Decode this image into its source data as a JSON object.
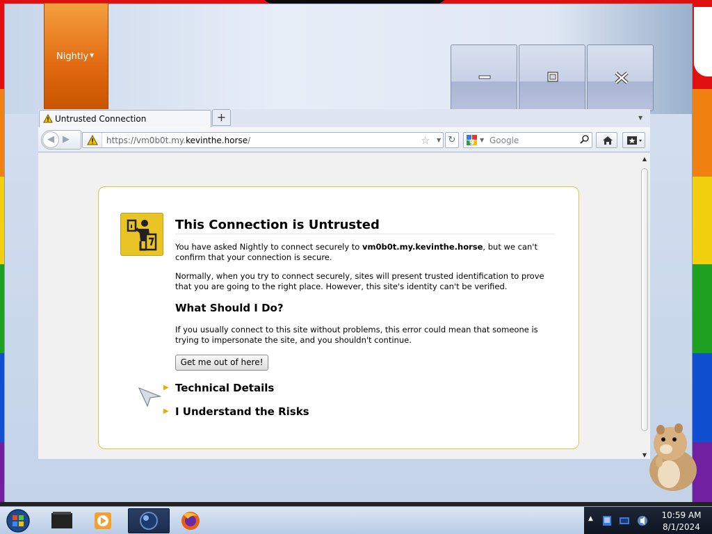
{
  "app": {
    "menu_button_label": "Nightly",
    "caption_buttons": [
      "minimize",
      "maximize",
      "close"
    ]
  },
  "tabs": [
    {
      "title": "Untrusted Connection",
      "icon": "warning-icon",
      "active": true
    }
  ],
  "toolbar": {
    "url_prefix": "https://vm0b0t.my.",
    "url_domain": "kevinthe.horse",
    "url_suffix": "/",
    "search_placeholder": "Google"
  },
  "error_page": {
    "title": "This Connection is Untrusted",
    "p1_before": "You have asked Nightly to connect securely to ",
    "p1_host": "vm0b0t.my.kevinthe.horse",
    "p1_after": ", but we can't confirm that your connection is secure.",
    "p2": "Normally, when you try to connect securely, sites will present trusted identification to prove that you are going to the right place. However, this site's identity can't be verified.",
    "what_heading": "What Should I Do?",
    "p3": "If you usually connect to this site without problems, this error could mean that someone is trying to impersonate the site, and you shouldn't continue.",
    "get_out_button": "Get me out of here!",
    "technical_details": "Technical Details",
    "understand_risks": "I Understand the Risks"
  },
  "taskbar": {
    "pinned": [
      "file-manager-icon",
      "media-player-icon",
      "browser-nightly-icon",
      "firefox-icon"
    ],
    "clock_time": "10:59 AM",
    "clock_date": "8/1/2024"
  },
  "colors": {
    "accent_orange": "#e06810",
    "error_border": "#e8c040",
    "warning_yellow": "#e8c424"
  }
}
